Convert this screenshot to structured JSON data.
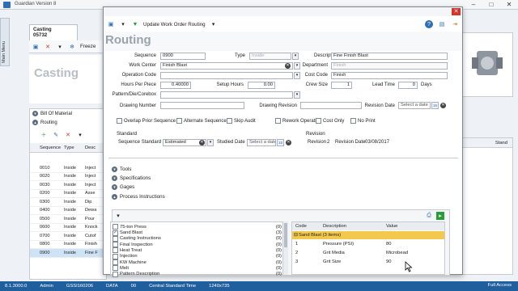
{
  "app": {
    "title": "Guardian Version 8",
    "side_tab": "Main Menu"
  },
  "back": {
    "tab_title": "Casting",
    "tab_sub": "05732",
    "toolbar_freeze": "Freeze",
    "heading": "Casting",
    "sections": {
      "bom": "Bill Of Material",
      "routing": "Routing"
    },
    "grid_headers": [
      "Sequence",
      "Type",
      "Desc"
    ],
    "grid_rows": [
      {
        "seq": "0010",
        "type": "Inside",
        "desc": "Inject"
      },
      {
        "seq": "0020",
        "type": "Inside",
        "desc": "Inject"
      },
      {
        "seq": "0030",
        "type": "Inside",
        "desc": "Inject"
      },
      {
        "seq": "0200",
        "type": "Inside",
        "desc": "Asse"
      },
      {
        "seq": "0300",
        "type": "Inside",
        "desc": "Dip"
      },
      {
        "seq": "0400",
        "type": "Inside",
        "desc": "Dewa"
      },
      {
        "seq": "0500",
        "type": "Inside",
        "desc": "Pour"
      },
      {
        "seq": "0600",
        "type": "Inside",
        "desc": "Knock"
      },
      {
        "seq": "0700",
        "type": "Inside",
        "desc": "Cutof"
      },
      {
        "seq": "0800",
        "type": "Inside",
        "desc": "Finish"
      },
      {
        "seq": "0900",
        "type": "Inside",
        "desc": "Fine F"
      }
    ],
    "right_grid_header": "Stand"
  },
  "dialog": {
    "toolbar_action": "Update Work Order Routing",
    "heading": "Routing",
    "fields": {
      "sequence": {
        "label": "Sequence",
        "value": "0900"
      },
      "type": {
        "label": "Type",
        "value": "Inside"
      },
      "description": {
        "label": "Description",
        "value": "Fine Finish Blast"
      },
      "work_center": {
        "label": "Work Center",
        "value": "Finish Blast"
      },
      "department": {
        "label": "Department",
        "value": "Finish"
      },
      "operation_code": {
        "label": "Operation Code",
        "value": ""
      },
      "cost_code": {
        "label": "Cost Code",
        "value": "Finish"
      },
      "hours_per_piece": {
        "label": "Hours Per Piece",
        "value": "0.40000"
      },
      "setup_hours": {
        "label": "Setup Hours",
        "value": "0.00"
      },
      "crew_size": {
        "label": "Crew Size",
        "value": "1"
      },
      "lead_time": {
        "label": "Lead Time",
        "value": "0"
      },
      "lead_time_unit": "Days",
      "pattern": {
        "label": "Pattern/Die/Corebox",
        "value": ""
      },
      "drawing_number": {
        "label": "Drawing Number",
        "value": ""
      },
      "drawing_revision": {
        "label": "Drawing Revision",
        "value": ""
      },
      "revision_date": {
        "label": "Revision Date",
        "placeholder": "Select a date"
      }
    },
    "checkboxes": [
      {
        "label": "Overlap Prior Sequence",
        "checked": false
      },
      {
        "label": "Alternate Sequence",
        "checked": false
      },
      {
        "label": "Skip Audit",
        "checked": false
      },
      {
        "label": "Rework Operation",
        "checked": false
      },
      {
        "label": "Cost Only",
        "checked": false
      },
      {
        "label": "No Print",
        "checked": false
      }
    ],
    "standard": {
      "title": "Standard",
      "seq_std_label": "Sequence Standard",
      "seq_std_value": "Estimated",
      "studied_label": "Studied Date",
      "studied_placeholder": "Select a date"
    },
    "revision": {
      "title": "Revision",
      "rev_label": "Revision",
      "rev_value": "2",
      "rev_date_label": "Revision Date",
      "rev_date_value": "03/08/2017"
    },
    "sections": [
      "Tools",
      "Specifications",
      "Gages",
      "Process Instructions"
    ],
    "instructions": [
      {
        "name": "75-ton Press",
        "count": "(0)",
        "checked": false
      },
      {
        "name": "Sand Blast",
        "count": "(3)",
        "checked": true
      },
      {
        "name": "Casting Instructions",
        "count": "(0)",
        "checked": false
      },
      {
        "name": "Final Inspection",
        "count": "(0)",
        "checked": false
      },
      {
        "name": "Heat Treat",
        "count": "(0)",
        "checked": false
      },
      {
        "name": "Injection",
        "count": "(0)",
        "checked": false
      },
      {
        "name": "KW Machine",
        "count": "(0)",
        "checked": false
      },
      {
        "name": "Melt",
        "count": "(0)",
        "checked": false
      },
      {
        "name": "Pattern Description",
        "count": "(0)",
        "checked": false
      }
    ],
    "detail": {
      "headers": [
        "Code",
        "Description",
        "Value"
      ],
      "group": "Sand Blast (3 items)",
      "rows": [
        {
          "code": "1",
          "desc": "Pressure (PSI)",
          "value": "80"
        },
        {
          "code": "2",
          "desc": "Grit Media",
          "value": "Microbead"
        },
        {
          "code": "3",
          "desc": "Grit Size",
          "value": "90"
        }
      ]
    }
  },
  "status": {
    "version": "8.1.3000.0",
    "user": "Admin",
    "server": "GSSI160206",
    "db": "DATA",
    "num": "00",
    "tz": "Central Standard Time",
    "res": "1240x735",
    "access": "Full Access"
  }
}
